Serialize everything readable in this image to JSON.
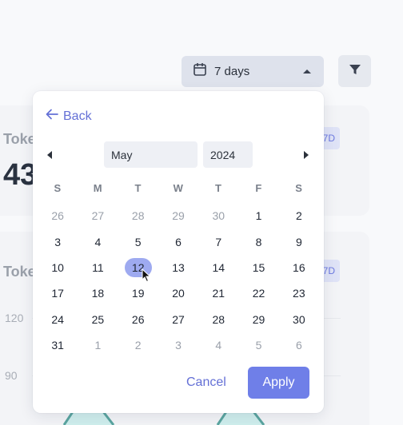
{
  "background": {
    "card1": {
      "title": "Toke",
      "value": "43",
      "badge": "7D"
    },
    "card2": {
      "title": "Toke",
      "badge": "7D",
      "axis": [
        "120",
        "90"
      ]
    }
  },
  "toolbar": {
    "range_label": "7 days",
    "calendar_icon": "calendar-icon",
    "caret_icon": "caret-up-icon",
    "filter_icon": "filter-icon"
  },
  "picker": {
    "back_label": "Back",
    "month": "May",
    "year": "2024",
    "weekdays": [
      "S",
      "M",
      "T",
      "W",
      "T",
      "F",
      "S"
    ],
    "days": [
      {
        "d": "26",
        "m": true
      },
      {
        "d": "27",
        "m": true
      },
      {
        "d": "28",
        "m": true
      },
      {
        "d": "29",
        "m": true
      },
      {
        "d": "30",
        "m": true
      },
      {
        "d": "1"
      },
      {
        "d": "2"
      },
      {
        "d": "3"
      },
      {
        "d": "4"
      },
      {
        "d": "5"
      },
      {
        "d": "6"
      },
      {
        "d": "7"
      },
      {
        "d": "8"
      },
      {
        "d": "9"
      },
      {
        "d": "10"
      },
      {
        "d": "11"
      },
      {
        "d": "12",
        "sel": true
      },
      {
        "d": "13"
      },
      {
        "d": "14"
      },
      {
        "d": "15"
      },
      {
        "d": "16"
      },
      {
        "d": "17"
      },
      {
        "d": "18"
      },
      {
        "d": "19"
      },
      {
        "d": "20"
      },
      {
        "d": "21"
      },
      {
        "d": "22"
      },
      {
        "d": "23"
      },
      {
        "d": "24"
      },
      {
        "d": "25"
      },
      {
        "d": "26"
      },
      {
        "d": "27"
      },
      {
        "d": "28"
      },
      {
        "d": "29"
      },
      {
        "d": "30"
      },
      {
        "d": "31"
      },
      {
        "d": "1",
        "m": true
      },
      {
        "d": "2",
        "m": true
      },
      {
        "d": "3",
        "m": true
      },
      {
        "d": "4",
        "m": true
      },
      {
        "d": "5",
        "m": true
      },
      {
        "d": "6",
        "m": true
      }
    ],
    "cancel_label": "Cancel",
    "apply_label": "Apply"
  },
  "colors": {
    "accent": "#6f7fe8",
    "link": "#6470d6",
    "selected_day": "#9eaaf0",
    "chart_line": "#5aa5a0"
  }
}
